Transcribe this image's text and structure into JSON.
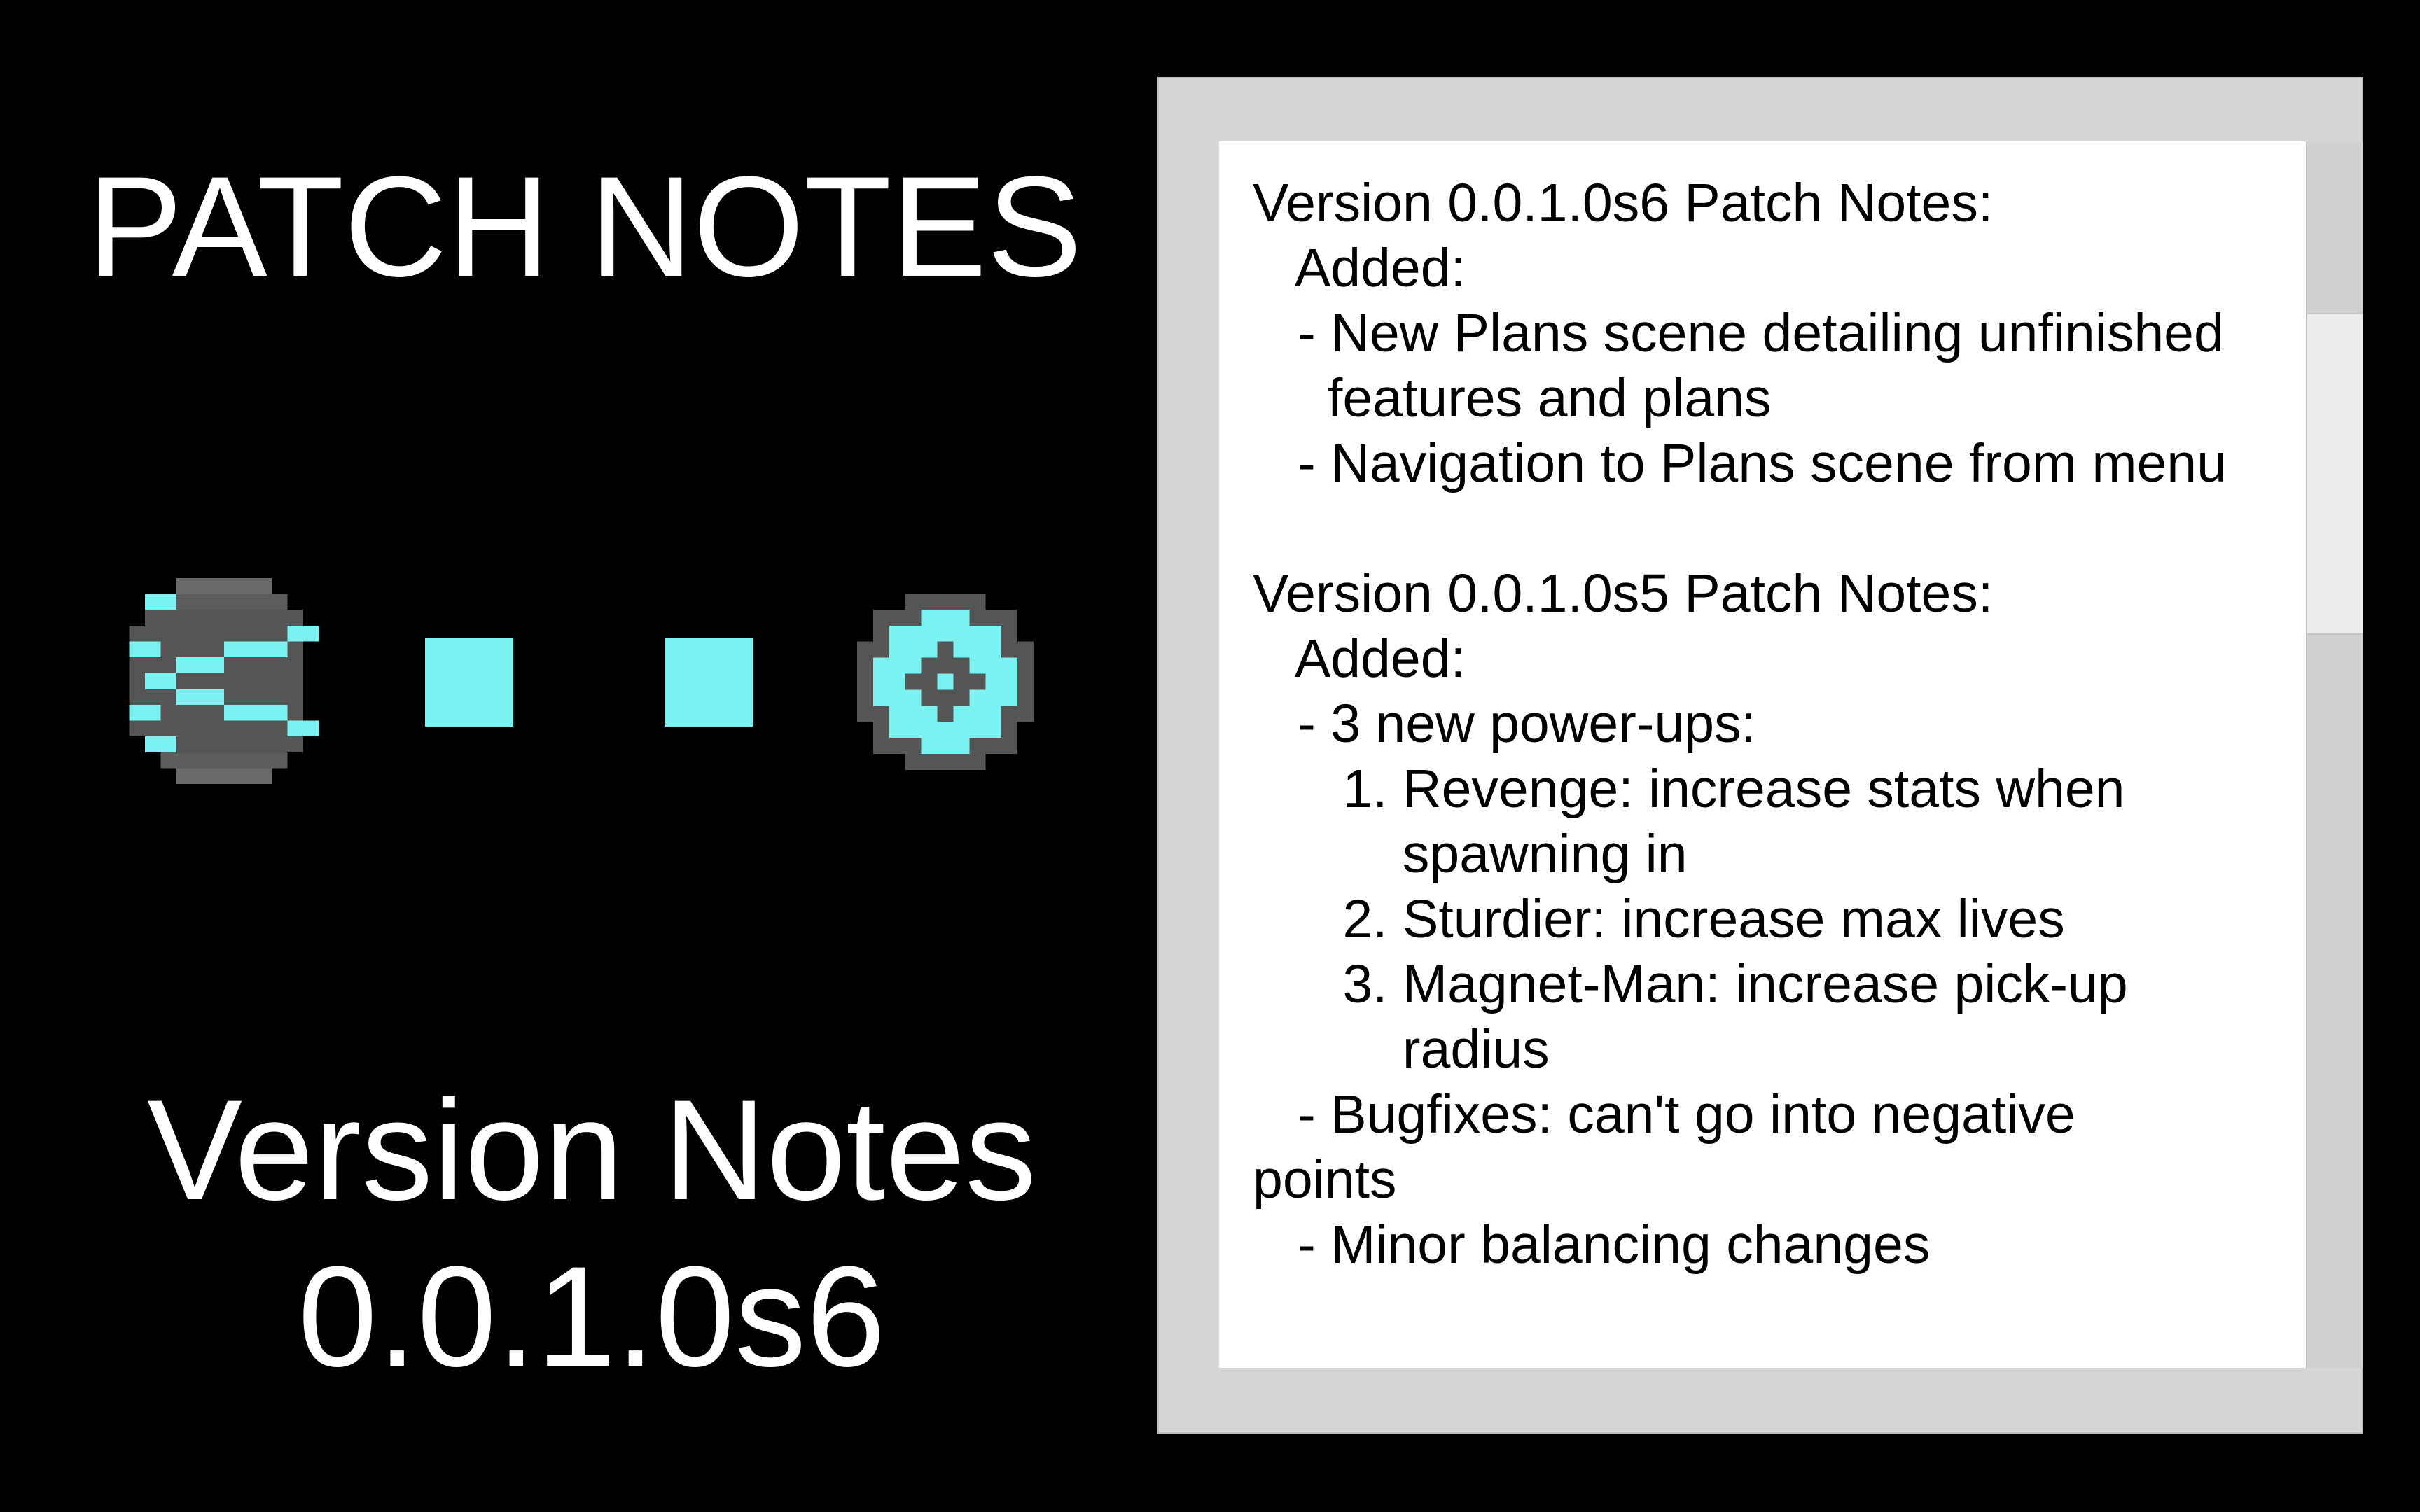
{
  "heading": "PATCH NOTES",
  "version": {
    "label": "Version Notes",
    "number": "0.0.1.0s6"
  },
  "sprites": [
    {
      "name": "ghost-enemy-icon"
    },
    {
      "name": "square-bullet-icon"
    },
    {
      "name": "square-bullet-icon"
    },
    {
      "name": "plus-shape-powerup-icon"
    }
  ],
  "colors": {
    "background": "#000000",
    "text": "#ffffff",
    "sprite_cyan": "#7af2f2",
    "sprite_gray": "#555555",
    "panel_frame": "#d6d6d6",
    "notes_background": "#ffffff"
  },
  "notes": "Version 0.0.1.0s6 Patch Notes:\n   Added:\n   - New Plans scene detailing unfinished\n     features and plans\n   - Navigation to Plans scene from menu\n\nVersion 0.0.1.0s5 Patch Notes:\n   Added:\n   - 3 new power-ups:\n      1. Revenge: increase stats when\n          spawning in\n      2. Sturdier: increase max lives\n      3. Magnet-Man: increase pick-up\n          radius\n   - Bugfixes: can't go into negative\npoints\n   - Minor balancing changes"
}
